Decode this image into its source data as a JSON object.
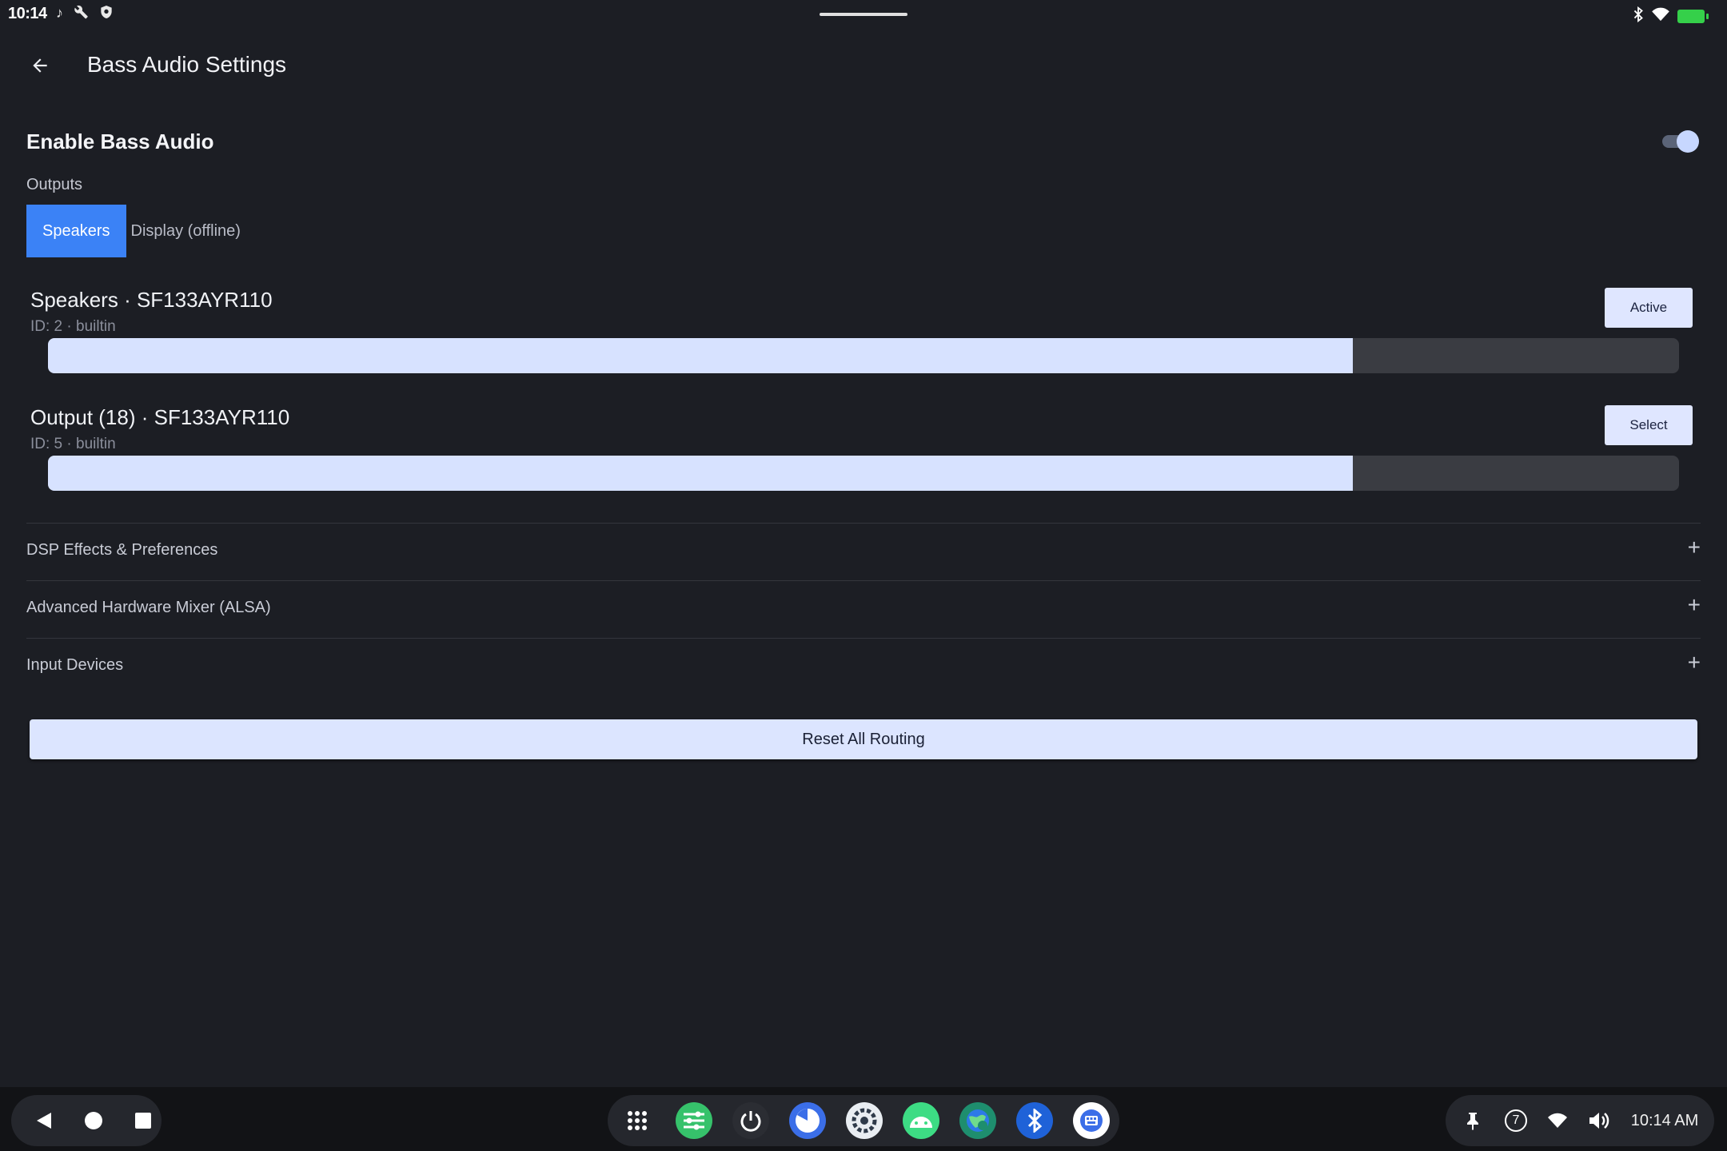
{
  "status_bar": {
    "time": "10:14",
    "left_icons": [
      "music-note-icon",
      "wrench-icon",
      "shield-icon"
    ],
    "right_icons": [
      "bluetooth-icon",
      "wifi-icon",
      "battery-charging-icon"
    ],
    "battery_color": "#35d04a"
  },
  "app_bar": {
    "title": "Bass Audio Settings",
    "back_icon": "arrow-left-icon"
  },
  "enable": {
    "label": "Enable Bass Audio",
    "enabled": true
  },
  "outputs": {
    "label": "Outputs",
    "tabs": [
      {
        "label": "Speakers",
        "active": true
      },
      {
        "label": "Display (offline)",
        "active": false
      }
    ],
    "accent": "#3b82f6"
  },
  "devices": [
    {
      "name": "Speakers · SF133AYR110",
      "id": "ID: 2 · builtin",
      "button": "Active",
      "level": 0.8
    },
    {
      "name": "Output (18) · SF133AYR110",
      "id": "ID: 5 · builtin",
      "button": "Select",
      "level": 0.8
    }
  ],
  "sections": [
    {
      "label": "DSP Effects & Preferences",
      "icon": "plus-icon"
    },
    {
      "label": "Advanced Hardware Mixer (ALSA)",
      "icon": "plus-icon"
    },
    {
      "label": "Input Devices",
      "icon": "plus-icon"
    }
  ],
  "reset_button": "Reset All Routing",
  "taskbar": {
    "nav": [
      "back-triangle-icon",
      "home-circle-icon",
      "recents-square-icon"
    ],
    "dock": [
      {
        "icon": "app-drawer-icon",
        "color": "#25272d"
      },
      {
        "icon": "equalizer-app-icon",
        "color": "#36c26b"
      },
      {
        "icon": "power-app-icon",
        "color": "#2b2d33"
      },
      {
        "icon": "pie-chart-app-icon",
        "color": "#3b6ee8"
      },
      {
        "icon": "settings-gear-app-icon",
        "color": "#e9edf2"
      },
      {
        "icon": "android-app-icon",
        "color": "#3ddc84"
      },
      {
        "icon": "globe-app-icon",
        "color": "#1e8e6e"
      },
      {
        "icon": "bluetooth-app-icon",
        "color": "#1f62d8"
      },
      {
        "icon": "keyboard-app-icon",
        "color": "#ffffff"
      }
    ],
    "tray": {
      "pin_icon": "pin-icon",
      "notification_count": "7",
      "wifi_icon": "wifi-icon",
      "volume_icon": "volume-icon",
      "clock": "10:14 AM"
    }
  }
}
